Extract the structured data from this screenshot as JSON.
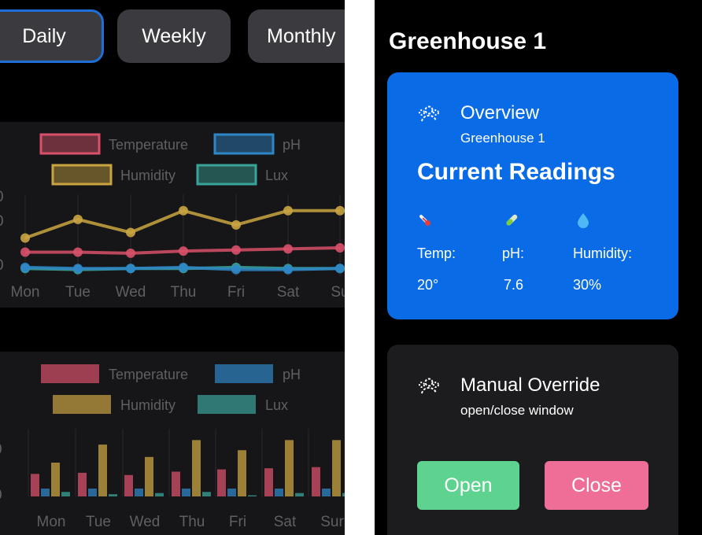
{
  "range_tabs": [
    {
      "label": "Daily",
      "active": true
    },
    {
      "label": "Weekly",
      "active": false
    },
    {
      "label": "Monthly",
      "active": false
    }
  ],
  "colors": {
    "temperature": "#d8506a",
    "ph": "#2f86c6",
    "humidity": "#c9a441",
    "lux": "#3aa39a",
    "accent": "#0a6be6",
    "open": "#5ed390",
    "close": "#ef6e97"
  },
  "chart_data": [
    {
      "type": "line",
      "categories": [
        "Mon",
        "Tue",
        "Wed",
        "Thu",
        "Fri",
        "Sat",
        "Su"
      ],
      "series": [
        {
          "name": "Temperature",
          "values": [
            22,
            22,
            21,
            23,
            24,
            25,
            26
          ]
        },
        {
          "name": "pH",
          "values": [
            8,
            7,
            7,
            8,
            6,
            6,
            7
          ]
        },
        {
          "name": "Humidity",
          "values": [
            35,
            52,
            40,
            60,
            47,
            60,
            60
          ]
        },
        {
          "name": "Lux",
          "values": [
            7,
            6,
            7,
            7,
            8,
            7,
            7
          ]
        }
      ],
      "ylim": [
        0,
        75
      ]
    },
    {
      "type": "bar",
      "categories": [
        "Mon",
        "Tue",
        "Wed",
        "Thu",
        "Fri",
        "Sat",
        "Sur"
      ],
      "series": [
        {
          "name": "Temperature",
          "values": [
            20,
            21,
            19,
            22,
            24,
            25,
            26
          ]
        },
        {
          "name": "pH",
          "values": [
            7,
            7,
            7,
            7,
            7,
            7,
            7
          ]
        },
        {
          "name": "Humidity",
          "values": [
            30,
            46,
            35,
            50,
            41,
            50,
            50
          ]
        },
        {
          "name": "Lux",
          "values": [
            4,
            2,
            3,
            4,
            1,
            3,
            3
          ]
        }
      ],
      "ylim": [
        0,
        60
      ]
    }
  ],
  "greenhouse": {
    "title": "Greenhouse 1",
    "overview": {
      "title": "Overview",
      "subtitle": "Greenhouse 1",
      "readings_title": "Current Readings",
      "readings": [
        {
          "icon": "thermometer-icon",
          "label": "Temp:",
          "value": "20°"
        },
        {
          "icon": "test-tube-icon",
          "label": "pH:",
          "value": "7.6"
        },
        {
          "icon": "water-drop-icon",
          "label": "Humidity:",
          "value": "30%"
        }
      ]
    },
    "override": {
      "title": "Manual Override",
      "subtitle": "open/close window",
      "open_label": "Open",
      "close_label": "Close"
    }
  }
}
